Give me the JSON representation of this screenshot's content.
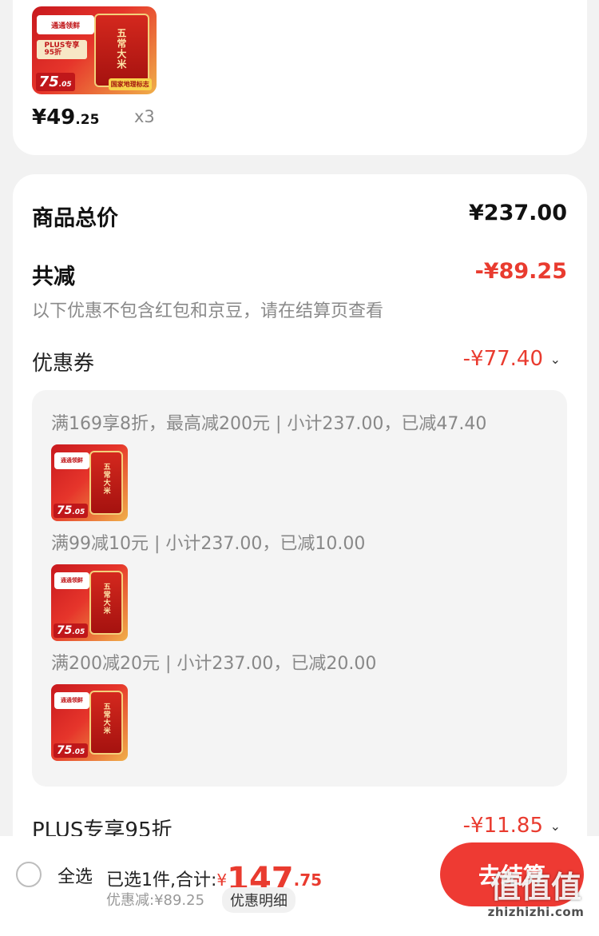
{
  "top_item": {
    "price_int": "¥49",
    "price_dec": ".25",
    "quantity": "x3",
    "image": {
      "bag_text": "五常大米",
      "tag_text": "通通领鲜",
      "plus_text": "PLUS专享\n95折",
      "price_int": "75",
      "price_dec": ".05",
      "badge_text": "国家地理标志"
    }
  },
  "summary": {
    "total_label": "商品总价",
    "total_value": "¥237.00",
    "reduce_label": "共减",
    "reduce_value": "-¥89.25",
    "note": "以下优惠不包含红包和京豆，请在结算页查看",
    "coupon_label": "优惠券",
    "coupon_value": "-¥77.40",
    "rules": [
      "满169享8折，最高减200元 | 小计237.00，已减47.40",
      "满99减10元 | 小计237.00，已减10.00",
      "满200减20元 | 小计237.00，已减20.00"
    ],
    "plus_label": "PLUS专享95折",
    "plus_value": "-¥11.85"
  },
  "bottom_bar": {
    "select_all": "全选",
    "selected_text": "已选1件,合计:",
    "yen": "¥",
    "total_int": "147",
    "total_dec": ".75",
    "discount_text": "优惠减:¥89.25",
    "detail_button": "优惠明细",
    "checkout_button": "去结算"
  },
  "watermark": {
    "main": "值值值",
    "sub": "zhizhizhi.com"
  },
  "colors": {
    "accent_red": "#e93b2f",
    "checkout_bg": "#ee3a33"
  }
}
